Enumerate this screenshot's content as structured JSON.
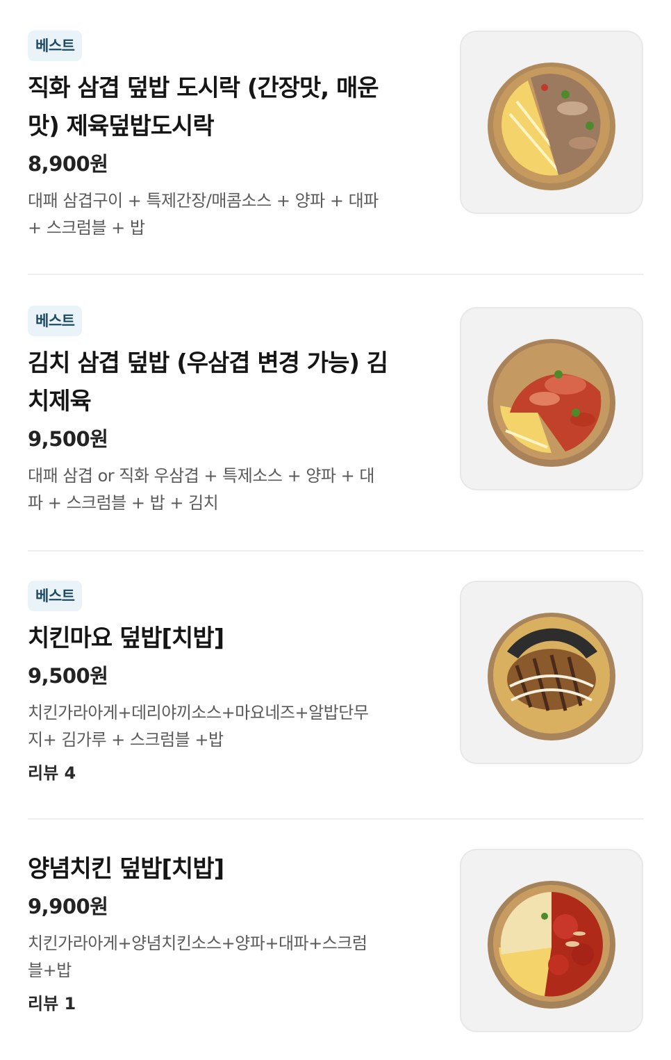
{
  "menu": {
    "items": [
      {
        "badge": "베스트",
        "name_line1": "직화 삼겹 덮밥 도시락 (간장맛, 매운",
        "name_line2": "맛) 제육덮밥도시락",
        "price": "8,900원",
        "desc_line1": "대패 삼겹구이 + 특제간장/매콤소스 + 양파 + 대파",
        "desc_line2": "+ 스크럼블 + 밥"
      },
      {
        "badge": "베스트",
        "name_line1": "김치 삼겹 덮밥 (우삼겹 변경 가능) 김",
        "name_line2": "치제육",
        "price": "9,500원",
        "desc_line1": "대패 삼겹 or 직화 우삼겹 + 특제소스 + 양파 + 대",
        "desc_line2": "파 + 스크럼블 + 밥 + 김치"
      },
      {
        "badge": "베스트",
        "name_line1": "치킨마요 덮밥[치밥]",
        "price": "9,500원",
        "desc_line1": "치킨가라아게+데리야끼소스+마요네즈+알밥단무",
        "desc_line2": "지+ 김가루 + 스크럼블 +밥",
        "review": "리뷰 4"
      },
      {
        "name_line1": "양념치킨 덮밥[치밥]",
        "price": "9,900원",
        "desc_line1": "치킨가라아게+양념치킨소스+양파+대파+스크럼",
        "desc_line2": "블+밥",
        "review": "리뷰 1"
      }
    ]
  },
  "icons": {
    "item1_photo": "pork-rice-bowl-image",
    "item2_photo": "kimchi-pork-rice-bowl-image",
    "item3_photo": "chicken-mayo-rice-bowl-image",
    "item4_photo": "yangnyeom-chicken-rice-bowl-image"
  },
  "colors": {
    "badge_bg": "#e9f3f8",
    "badge_text": "#1f4a63",
    "divider": "#eeeeee",
    "thumb_bg": "#f2f2f2"
  }
}
